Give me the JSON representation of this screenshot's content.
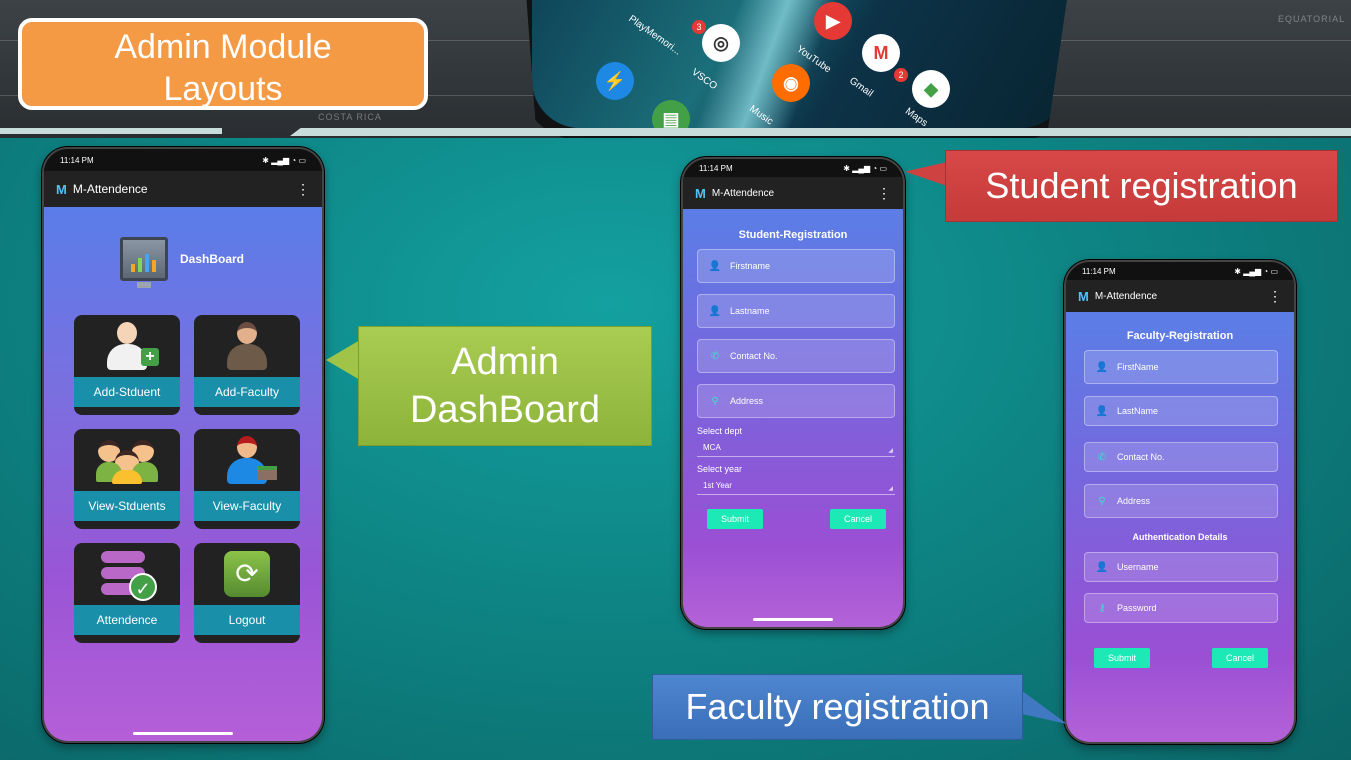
{
  "slide_title": "Admin Module Layouts",
  "callouts": {
    "admin": "Admin DashBoard",
    "student": "Student registration",
    "faculty": "Faculty registration"
  },
  "top_phone": {
    "apps": [
      "PlayMemori...",
      "VSCO",
      "YouTube",
      "Gmail",
      "Music",
      "Maps"
    ],
    "badges": [
      "3",
      "2",
      "2"
    ],
    "map_labels": [
      "COSTA RICA",
      "EQUATORIAL"
    ]
  },
  "status_bar": {
    "time": "11:14 PM"
  },
  "app": {
    "name": "M-Attendence",
    "logo": "M"
  },
  "dashboard": {
    "title": "DashBoard",
    "tiles": [
      {
        "label": "Add-Stduent",
        "icon": "add-student-icon"
      },
      {
        "label": "Add-Faculty",
        "icon": "add-faculty-icon"
      },
      {
        "label": "View-Stduents",
        "icon": "view-students-icon"
      },
      {
        "label": "View-Faculty",
        "icon": "view-faculty-icon"
      },
      {
        "label": "Attendence",
        "icon": "attendance-icon"
      },
      {
        "label": "Logout",
        "icon": "logout-icon"
      }
    ]
  },
  "student_form": {
    "title": "Student-Registration",
    "fields": [
      {
        "placeholder": "Firstname",
        "icon": "person-add-icon"
      },
      {
        "placeholder": "Lastname",
        "icon": "person-add-icon"
      },
      {
        "placeholder": "Contact No.",
        "icon": "phone-icon"
      },
      {
        "placeholder": "Address",
        "icon": "location-icon"
      }
    ],
    "dept_label": "Select dept",
    "dept_value": "MCA",
    "year_label": "Select year",
    "year_value": "1st Year",
    "submit": "Submit",
    "cancel": "Cancel"
  },
  "faculty_form": {
    "title": "Faculty-Registration",
    "fields": [
      {
        "placeholder": "FirstName",
        "icon": "person-add-icon"
      },
      {
        "placeholder": "LastName",
        "icon": "person-add-icon"
      },
      {
        "placeholder": "Contact No.",
        "icon": "phone-icon"
      },
      {
        "placeholder": "Address",
        "icon": "location-icon"
      }
    ],
    "auth_title": "Authentication Details",
    "auth_fields": [
      {
        "placeholder": "Username",
        "icon": "person-icon"
      },
      {
        "placeholder": "Password",
        "icon": "key-icon"
      }
    ],
    "submit": "Submit",
    "cancel": "Cancel"
  },
  "colors": {
    "background": "#0e8585",
    "title_box": "#f59a44",
    "callout_admin": "#9fc448",
    "callout_student": "#cf4242",
    "callout_faculty": "#4178c2",
    "tile_label": "#1a8faa",
    "button": "#1de9b6"
  }
}
